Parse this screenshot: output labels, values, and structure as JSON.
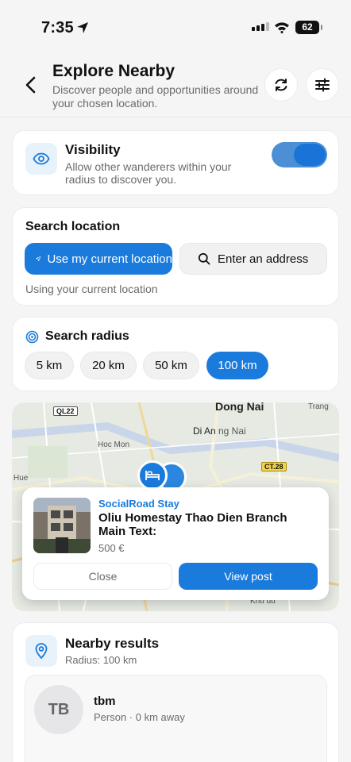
{
  "status_bar": {
    "time": "7:35",
    "battery": "62"
  },
  "header": {
    "title": "Explore Nearby",
    "subtitle": "Discover people and opportunities around your chosen location.",
    "icons": [
      "back-icon",
      "refresh-icon",
      "filters-icon"
    ]
  },
  "visibility": {
    "title": "Visibility",
    "description": "Allow other wanderers within your radius to discover you.",
    "enabled": true
  },
  "search_location": {
    "title": "Search location",
    "use_current_label": "Use my current location",
    "enter_address_label": "Enter an address",
    "note": "Using your current location"
  },
  "search_radius": {
    "title": "Search radius",
    "options": [
      "5 km",
      "20 km",
      "50 km",
      "100 km"
    ],
    "selected": "100 km"
  },
  "map": {
    "places": [
      "Dong Nai",
      "Di An",
      "Hoc Mon",
      "ng Nai",
      "Trang",
      "Hue"
    ],
    "road_labels": [
      "QL22",
      "CT.28"
    ],
    "footer_text": "Khu du"
  },
  "popup": {
    "brand": "SocialRoad Stay",
    "title": "Oliu Homestay Thao Dien Branch Main Text:",
    "price": "500 €",
    "close_label": "Close",
    "view_label": "View post"
  },
  "nearby": {
    "title": "Nearby results",
    "subtitle": "Radius: 100 km",
    "results": [
      {
        "initials": "TB",
        "name": "tbm",
        "meta": "Person · 0 km away"
      }
    ]
  },
  "colors": {
    "accent": "#1a7bdc",
    "toggle_track": "#4d8fd4"
  }
}
